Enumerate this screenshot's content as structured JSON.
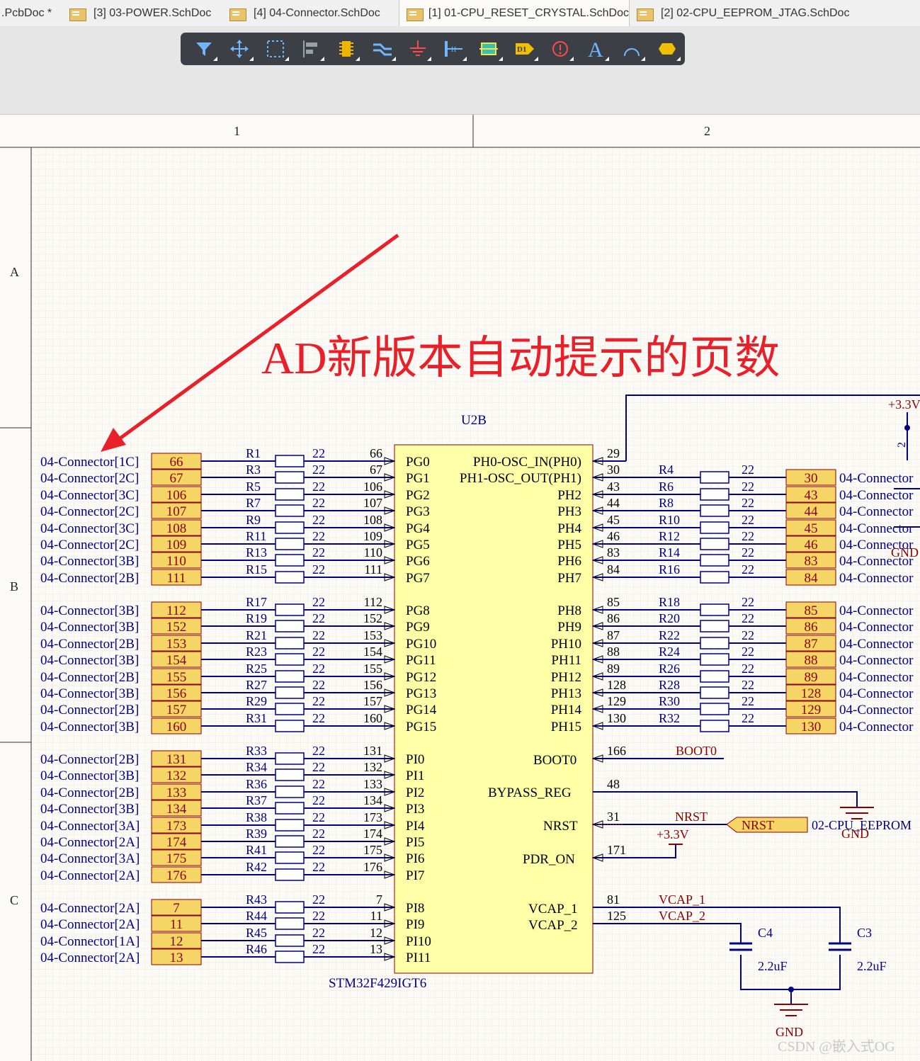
{
  "tabs": [
    {
      "label": ".PcbDoc *",
      "icon": "pcb-doc-icon",
      "active": false
    },
    {
      "label": "[3] 03-POWER.SchDoc",
      "icon": "schdoc-icon",
      "active": false
    },
    {
      "label": "[4] 04-Connector.SchDoc",
      "icon": "schdoc-icon",
      "active": false
    },
    {
      "label": "[1] 01-CPU_RESET_CRYSTAL.SchDoc",
      "icon": "schdoc-icon",
      "active": true
    },
    {
      "label": "[2] 02-CPU_EEPROM_JTAG.SchDoc",
      "icon": "schdoc-icon",
      "active": false
    }
  ],
  "toolbar": [
    "filter-icon",
    "move-icon",
    "select-rect-icon",
    "align-icon",
    "component-icon",
    "bus-icon",
    "ground-icon",
    "wire-label-icon",
    "harness-icon",
    "part-d1-icon",
    "directive-icon",
    "text-icon",
    "arc-icon",
    "shape-icon"
  ],
  "toolbar_d1_label": "D1",
  "toolbar_text_label": "A",
  "border": {
    "columns": [
      "1",
      "2"
    ],
    "rows": [
      "A",
      "B",
      "C"
    ]
  },
  "annotation": "AD新版本自动提示的页数",
  "chip": {
    "designator": "U2B",
    "part": "STM32F429IGT6"
  },
  "colors": {
    "wire": "#000080",
    "net": "#8b0000",
    "port_fill": "#f5d565",
    "port_text": "#8b0000",
    "chip_fill": "#ffffa8",
    "annotation": "#e8202a"
  },
  "left_groups": [
    [
      {
        "conn": "04-Connector[1C]",
        "port": "66",
        "res": "R1",
        "val": "22",
        "pin": "66",
        "name": "PG0"
      },
      {
        "conn": "04-Connector[2C]",
        "port": "67",
        "res": "R3",
        "val": "22",
        "pin": "67",
        "name": "PG1"
      },
      {
        "conn": "04-Connector[3C]",
        "port": "106",
        "res": "R5",
        "val": "22",
        "pin": "106",
        "name": "PG2"
      },
      {
        "conn": "04-Connector[2C]",
        "port": "107",
        "res": "R7",
        "val": "22",
        "pin": "107",
        "name": "PG3"
      },
      {
        "conn": "04-Connector[3C]",
        "port": "108",
        "res": "R9",
        "val": "22",
        "pin": "108",
        "name": "PG4"
      },
      {
        "conn": "04-Connector[2C]",
        "port": "109",
        "res": "R11",
        "val": "22",
        "pin": "109",
        "name": "PG5"
      },
      {
        "conn": "04-Connector[3B]",
        "port": "110",
        "res": "R13",
        "val": "22",
        "pin": "110",
        "name": "PG6"
      },
      {
        "conn": "04-Connector[2B]",
        "port": "111",
        "res": "R15",
        "val": "22",
        "pin": "111",
        "name": "PG7"
      }
    ],
    [
      {
        "conn": "04-Connector[3B]",
        "port": "112",
        "res": "R17",
        "val": "22",
        "pin": "112",
        "name": "PG8"
      },
      {
        "conn": "04-Connector[3B]",
        "port": "152",
        "res": "R19",
        "val": "22",
        "pin": "152",
        "name": "PG9"
      },
      {
        "conn": "04-Connector[2B]",
        "port": "153",
        "res": "R21",
        "val": "22",
        "pin": "153",
        "name": "PG10"
      },
      {
        "conn": "04-Connector[3B]",
        "port": "154",
        "res": "R23",
        "val": "22",
        "pin": "154",
        "name": "PG11"
      },
      {
        "conn": "04-Connector[2B]",
        "port": "155",
        "res": "R25",
        "val": "22",
        "pin": "155",
        "name": "PG12"
      },
      {
        "conn": "04-Connector[3B]",
        "port": "156",
        "res": "R27",
        "val": "22",
        "pin": "156",
        "name": "PG13"
      },
      {
        "conn": "04-Connector[2B]",
        "port": "157",
        "res": "R29",
        "val": "22",
        "pin": "157",
        "name": "PG14"
      },
      {
        "conn": "04-Connector[3B]",
        "port": "160",
        "res": "R31",
        "val": "22",
        "pin": "160",
        "name": "PG15"
      }
    ],
    [
      {
        "conn": "04-Connector[2B]",
        "port": "131",
        "res": "R33",
        "val": "22",
        "pin": "131",
        "name": "PI0"
      },
      {
        "conn": "04-Connector[3B]",
        "port": "132",
        "res": "R34",
        "val": "22",
        "pin": "132",
        "name": "PI1"
      },
      {
        "conn": "04-Connector[2B]",
        "port": "133",
        "res": "R36",
        "val": "22",
        "pin": "133",
        "name": "PI2"
      },
      {
        "conn": "04-Connector[3B]",
        "port": "134",
        "res": "R37",
        "val": "22",
        "pin": "134",
        "name": "PI3"
      },
      {
        "conn": "04-Connector[3A]",
        "port": "173",
        "res": "R38",
        "val": "22",
        "pin": "173",
        "name": "PI4"
      },
      {
        "conn": "04-Connector[2A]",
        "port": "174",
        "res": "R39",
        "val": "22",
        "pin": "174",
        "name": "PI5"
      },
      {
        "conn": "04-Connector[3A]",
        "port": "175",
        "res": "R41",
        "val": "22",
        "pin": "175",
        "name": "PI6"
      },
      {
        "conn": "04-Connector[2A]",
        "port": "176",
        "res": "R42",
        "val": "22",
        "pin": "176",
        "name": "PI7"
      }
    ],
    [
      {
        "conn": "04-Connector[2A]",
        "port": "7",
        "res": "R43",
        "val": "22",
        "pin": "7",
        "name": "PI8"
      },
      {
        "conn": "04-Connector[2A]",
        "port": "11",
        "res": "R44",
        "val": "22",
        "pin": "11",
        "name": "PI9"
      },
      {
        "conn": "04-Connector[1A]",
        "port": "12",
        "res": "R45",
        "val": "22",
        "pin": "12",
        "name": "PI10"
      },
      {
        "conn": "04-Connector[2A]",
        "port": "13",
        "res": "R46",
        "val": "22",
        "pin": "13",
        "name": "PI11"
      }
    ]
  ],
  "right_groups": [
    [
      {
        "name": "PH0-OSC_IN(PH0)",
        "pin": "29"
      },
      {
        "name": "PH1-OSC_OUT(PH1)",
        "pin": "30",
        "res": "R4",
        "val": "22",
        "port": "30",
        "conn": "04-Connector"
      },
      {
        "name": "PH2",
        "pin": "43",
        "res": "R6",
        "val": "22",
        "port": "43",
        "conn": "04-Connector"
      },
      {
        "name": "PH3",
        "pin": "44",
        "res": "R8",
        "val": "22",
        "port": "44",
        "conn": "04-Connector"
      },
      {
        "name": "PH4",
        "pin": "45",
        "res": "R10",
        "val": "22",
        "port": "45",
        "conn": "04-Connector"
      },
      {
        "name": "PH5",
        "pin": "46",
        "res": "R12",
        "val": "22",
        "port": "46",
        "conn": "04-Connector"
      },
      {
        "name": "PH6",
        "pin": "83",
        "res": "R14",
        "val": "22",
        "port": "83",
        "conn": "04-Connector"
      },
      {
        "name": "PH7",
        "pin": "84",
        "res": "R16",
        "val": "22",
        "port": "84",
        "conn": "04-Connector"
      }
    ],
    [
      {
        "name": "PH8",
        "pin": "85",
        "res": "R18",
        "val": "22",
        "port": "85",
        "conn": "04-Connector"
      },
      {
        "name": "PH9",
        "pin": "86",
        "res": "R20",
        "val": "22",
        "port": "86",
        "conn": "04-Connector"
      },
      {
        "name": "PH10",
        "pin": "87",
        "res": "R22",
        "val": "22",
        "port": "87",
        "conn": "04-Connector"
      },
      {
        "name": "PH11",
        "pin": "88",
        "res": "R24",
        "val": "22",
        "port": "88",
        "conn": "04-Connector"
      },
      {
        "name": "PH12",
        "pin": "89",
        "res": "R26",
        "val": "22",
        "port": "89",
        "conn": "04-Connector"
      },
      {
        "name": "PH13",
        "pin": "128",
        "res": "R28",
        "val": "22",
        "port": "128",
        "conn": "04-Connector"
      },
      {
        "name": "PH14",
        "pin": "129",
        "res": "R30",
        "val": "22",
        "port": "129",
        "conn": "04-Connector"
      },
      {
        "name": "PH15",
        "pin": "130",
        "res": "R32",
        "val": "22",
        "port": "130",
        "conn": "04-Connector"
      }
    ]
  ],
  "special": {
    "boot0": {
      "name": "BOOT0",
      "pin": "166",
      "net": "BOOT0"
    },
    "bypass": {
      "name": "BYPASS_REG",
      "pin": "48"
    },
    "nrst": {
      "name": "NRST",
      "pin": "31",
      "net": "NRST",
      "port": "NRST",
      "conn": "02-CPU_EEPROM"
    },
    "pdr": {
      "name": "PDR_ON",
      "pin": "171"
    },
    "vcap1": {
      "name": "VCAP_1",
      "pin": "81",
      "net": "VCAP_1"
    },
    "vcap2": {
      "name": "VCAP_2",
      "pin": "125",
      "net": "VCAP_2"
    },
    "c4": {
      "des": "C4",
      "val": "2.2uF"
    },
    "c3": {
      "des": "C3",
      "val": "2.2uF"
    },
    "power_labels": {
      "top": "+3.3V",
      "pdr": "+3.3V",
      "gnd": "GND",
      "gnd_partial": "GND",
      "top_cap_des": "2"
    }
  },
  "watermark": "CSDN @嵌入式OG"
}
